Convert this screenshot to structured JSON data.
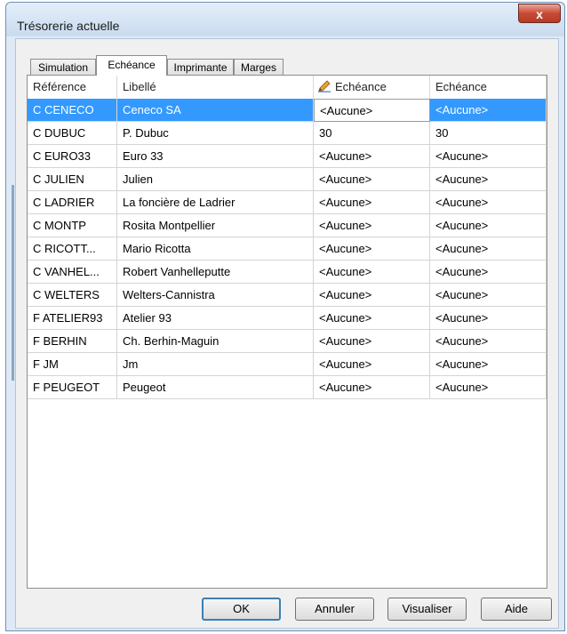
{
  "window": {
    "title": "Trésorerie actuelle",
    "close_glyph": "x"
  },
  "tabs": [
    {
      "label": "Simulation",
      "active": false
    },
    {
      "label": "Echéance",
      "active": true
    },
    {
      "label": "Imprimante",
      "active": false
    },
    {
      "label": "Marges",
      "active": false
    }
  ],
  "grid": {
    "columns": [
      {
        "label": "Référence",
        "icon": null
      },
      {
        "label": "Libellé",
        "icon": null
      },
      {
        "label": "Echéance",
        "icon": "pencil-icon"
      },
      {
        "label": "Echéance",
        "icon": null
      }
    ],
    "rows": [
      {
        "ref": "C CENECO",
        "libelle": "Ceneco SA",
        "echeance1": "<Aucune>",
        "echeance2": "<Aucune>",
        "selected": true
      },
      {
        "ref": "C DUBUC",
        "libelle": "P. Dubuc",
        "echeance1": "30",
        "echeance2": "30",
        "selected": false
      },
      {
        "ref": "C EURO33",
        "libelle": "Euro 33",
        "echeance1": "<Aucune>",
        "echeance2": "<Aucune>",
        "selected": false
      },
      {
        "ref": "C JULIEN",
        "libelle": "Julien",
        "echeance1": "<Aucune>",
        "echeance2": "<Aucune>",
        "selected": false
      },
      {
        "ref": "C LADRIER",
        "libelle": "La foncière de Ladrier",
        "echeance1": "<Aucune>",
        "echeance2": "<Aucune>",
        "selected": false
      },
      {
        "ref": "C MONTP",
        "libelle": "Rosita Montpellier",
        "echeance1": "<Aucune>",
        "echeance2": "<Aucune>",
        "selected": false
      },
      {
        "ref": "C RICOTT...",
        "libelle": "Mario Ricotta",
        "echeance1": "<Aucune>",
        "echeance2": "<Aucune>",
        "selected": false
      },
      {
        "ref": "C VANHEL...",
        "libelle": "Robert Vanhelleputte",
        "echeance1": "<Aucune>",
        "echeance2": "<Aucune>",
        "selected": false
      },
      {
        "ref": "C WELTERS",
        "libelle": "Welters-Cannistra",
        "echeance1": "<Aucune>",
        "echeance2": "<Aucune>",
        "selected": false
      },
      {
        "ref": "F ATELIER93",
        "libelle": "Atelier 93",
        "echeance1": "<Aucune>",
        "echeance2": "<Aucune>",
        "selected": false
      },
      {
        "ref": "F BERHIN",
        "libelle": "Ch. Berhin-Maguin",
        "echeance1": "<Aucune>",
        "echeance2": "<Aucune>",
        "selected": false
      },
      {
        "ref": "F JM",
        "libelle": "Jm",
        "echeance1": "<Aucune>",
        "echeance2": "<Aucune>",
        "selected": false
      },
      {
        "ref": "F PEUGEOT",
        "libelle": "Peugeot",
        "echeance1": "<Aucune>",
        "echeance2": "<Aucune>",
        "selected": false
      }
    ]
  },
  "buttons": {
    "ok": "OK",
    "cancel": "Annuler",
    "preview": "Visualiser",
    "help": "Aide"
  },
  "colors": {
    "selection": "#3399ff",
    "title_bar": "#c9dbef",
    "close_button": "#c84b35"
  }
}
